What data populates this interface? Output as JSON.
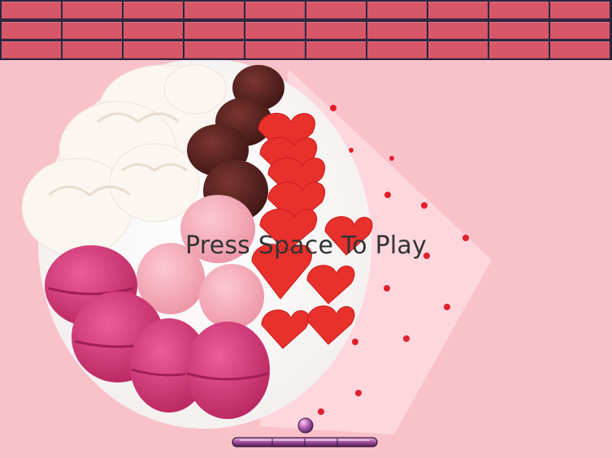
{
  "prompt": {
    "text": "Press Space To Play"
  },
  "bricks": {
    "rows": 3,
    "columns": 10,
    "color": "#d65868",
    "gap_color": "#2b2640"
  },
  "colors": {
    "background": "#f9c1c9",
    "plate": "#ffffff",
    "napkin": "#fdd7dd",
    "macaron": "#d83a78",
    "meringue": "#f6aab8",
    "whipped_cream": "#fbf5ef",
    "chocolate": "#5a2320",
    "gummy_heart": "#e8302c",
    "paddle": "#a04a9a",
    "ball": "#c56ac0"
  },
  "icons": {
    "ball": "ball-icon",
    "paddle": "paddle-icon"
  }
}
